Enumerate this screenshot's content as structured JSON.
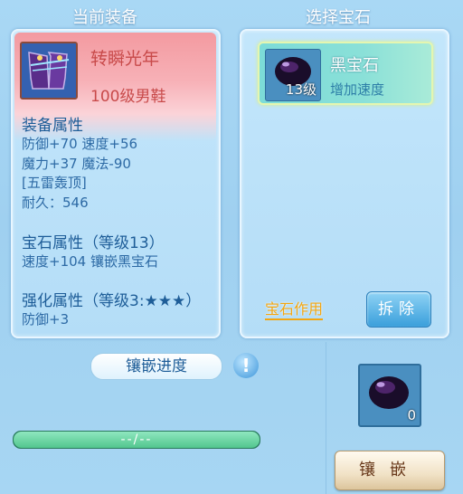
{
  "headers": {
    "left": "当前装备",
    "right": "选择宝石"
  },
  "equipment": {
    "icon": "purple-boots-icon",
    "name": "转瞬光年",
    "type": "100级男鞋",
    "attr_title": "装备属性",
    "attr_line1": "防御+70 速度+56",
    "attr_line2": "魔力+37 魔法-90",
    "special": "[五雷轰顶]",
    "durability": "耐久：546",
    "gem_title": "宝石属性（等级13）",
    "gem_line": "速度+104 镶嵌黑宝石",
    "enhance_title": "强化属性（等级3:★★★）",
    "enhance_line": "防御+3"
  },
  "gem": {
    "icon": "black-gem-icon",
    "level": "13级",
    "name": "黑宝石",
    "desc": "增加速度",
    "effect_link": "宝石作用",
    "remove_button": "拆除"
  },
  "progress": {
    "label": "镶嵌进度",
    "value_text": "--/--",
    "help_icon": "exclamation-icon",
    "fill": 1.0
  },
  "inlay": {
    "slot_count": "0",
    "button": "镶嵌"
  },
  "colors": {
    "accent_blue": "#3a9fdb",
    "progress_green": "#5fcf9a",
    "name_red": "#c84a4a"
  }
}
